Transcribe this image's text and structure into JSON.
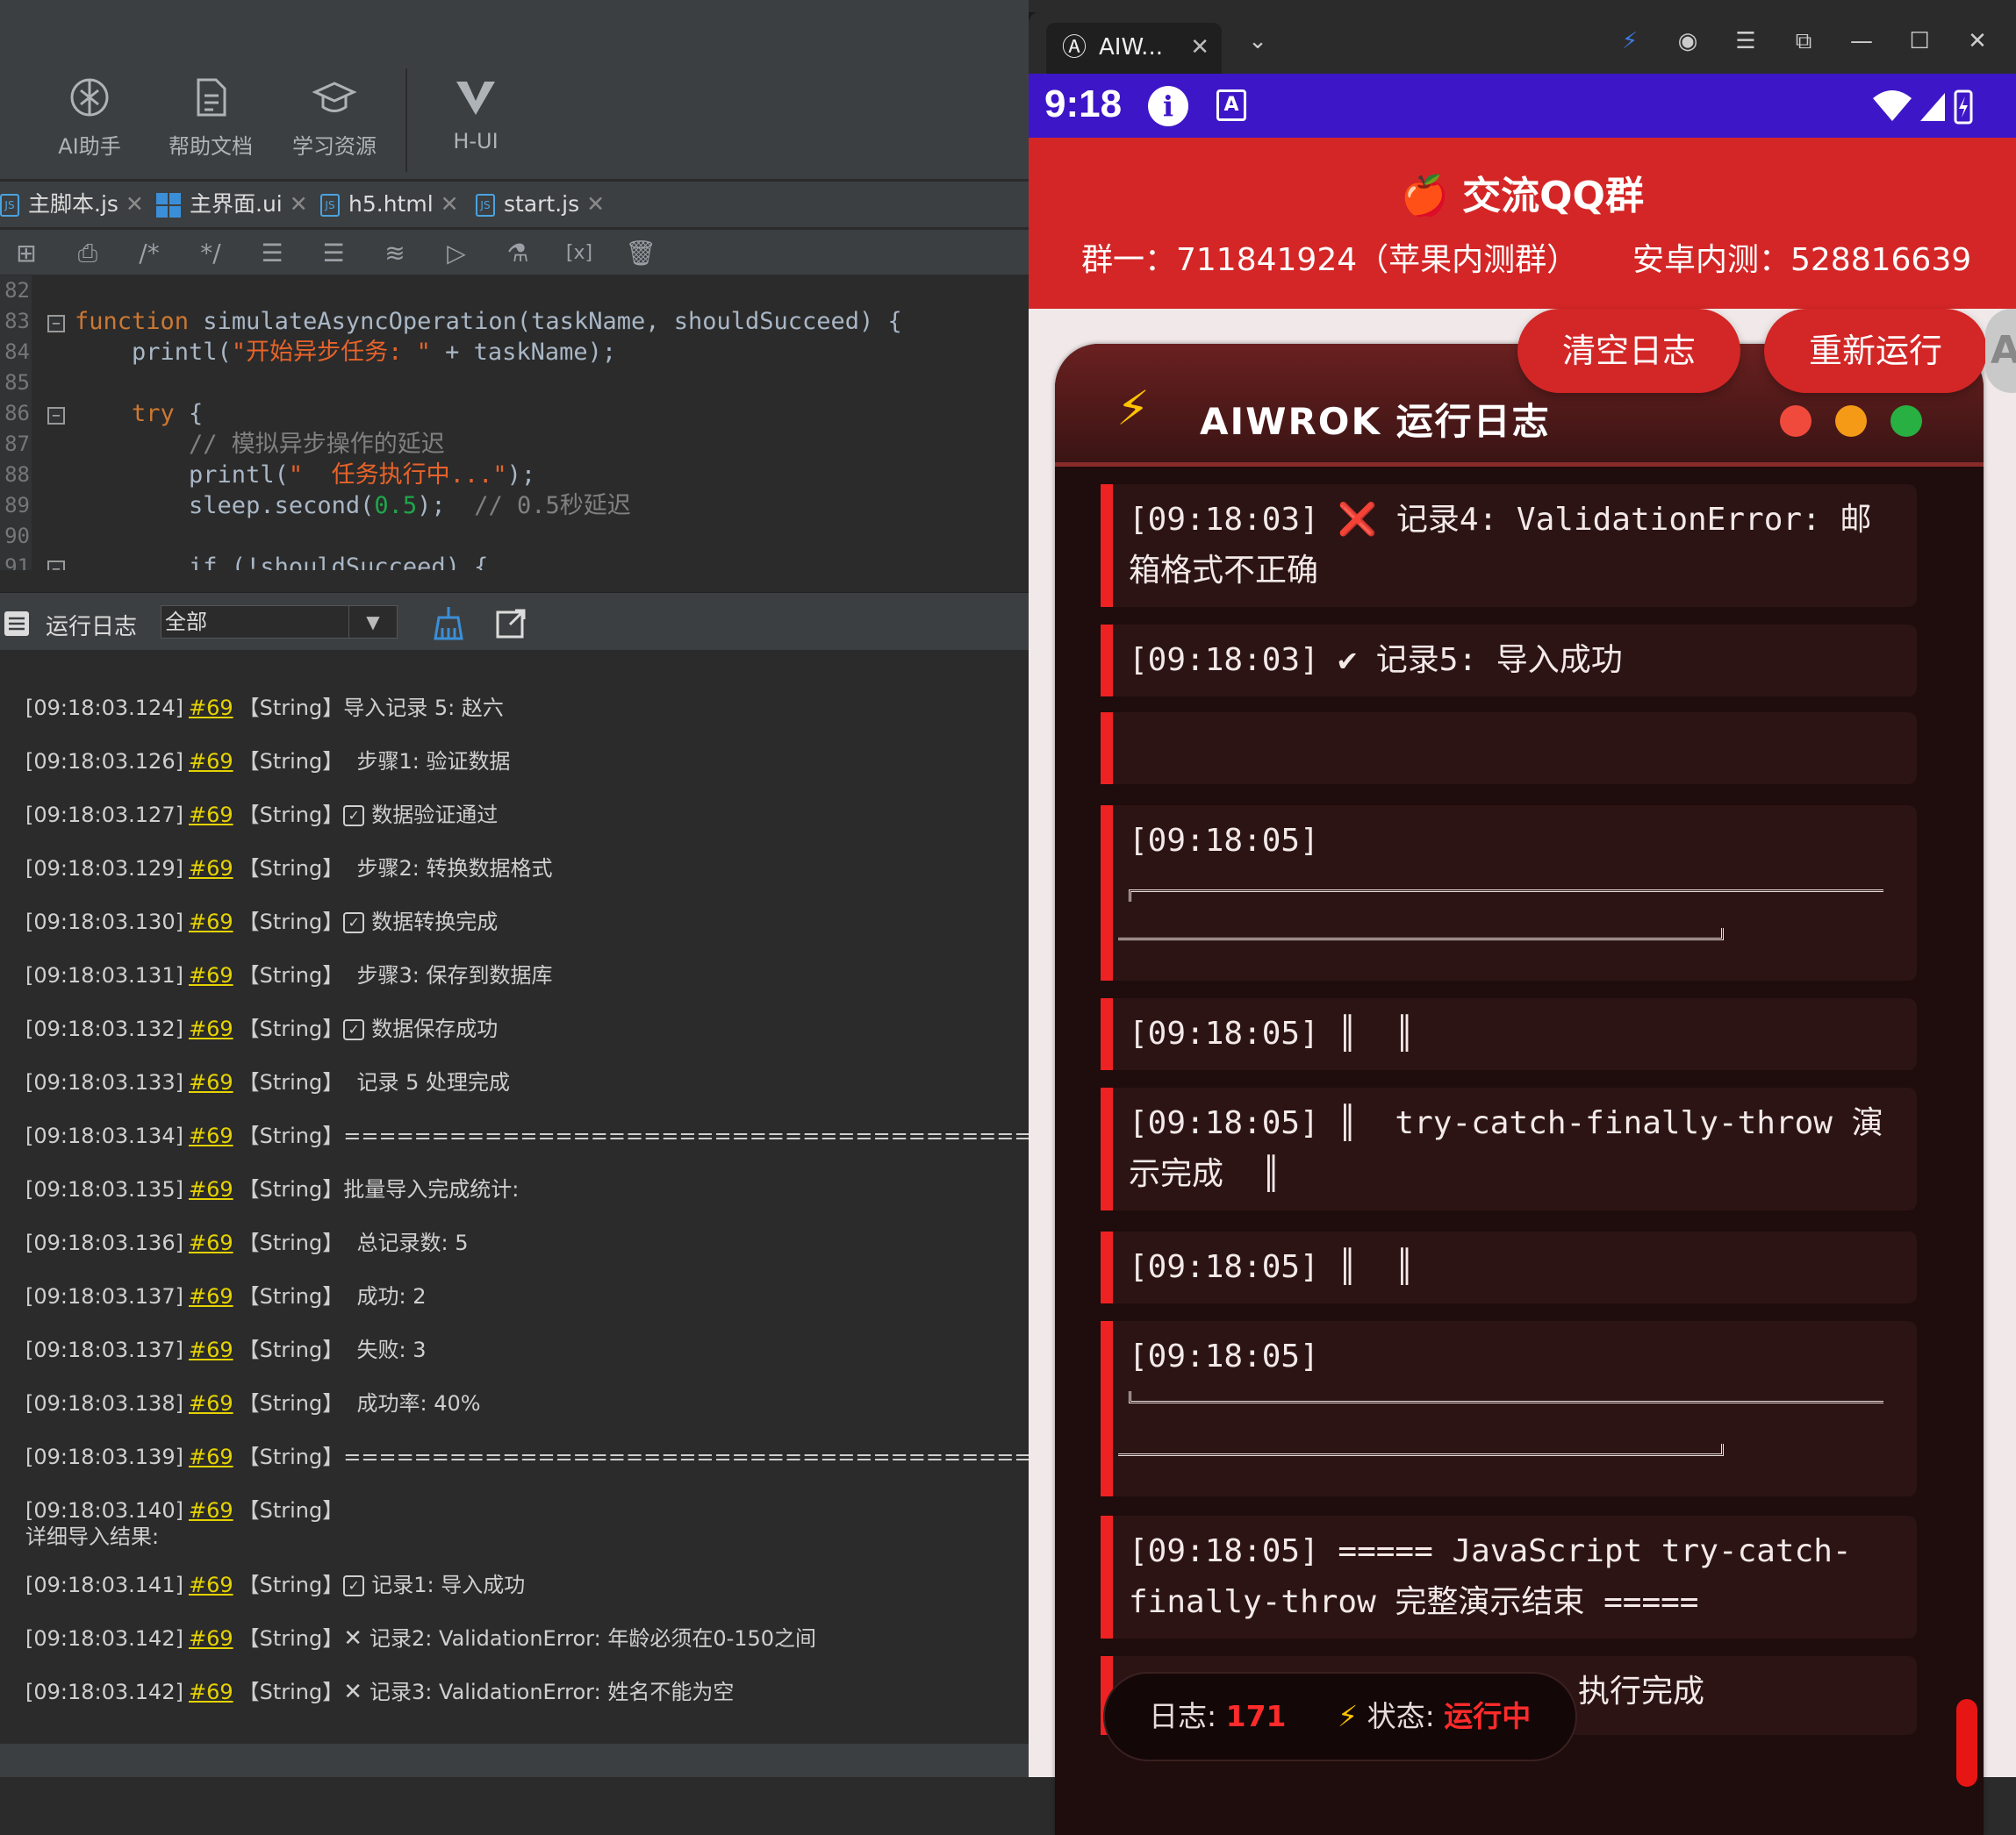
{
  "toolbar": {
    "items": [
      {
        "label": "AI助手",
        "icon": "ai-assistant-icon"
      },
      {
        "label": "帮助文档",
        "icon": "document-icon"
      },
      {
        "label": "学习资源",
        "icon": "graduation-cap-icon"
      },
      {
        "label": "H-UI",
        "icon": "h-ui-logo-icon"
      }
    ]
  },
  "tabs": [
    {
      "label": "主脚本.js"
    },
    {
      "label": "主界面.ui"
    },
    {
      "label": "h5.html"
    },
    {
      "label": "start.js"
    }
  ],
  "editor": {
    "line_numbers": [
      "82",
      "83",
      "84",
      "85",
      "86",
      "87",
      "88",
      "89",
      "90",
      "91"
    ],
    "lines": [
      {
        "k": "function",
        "t": " simulateAsyncOperation(taskName, shouldSucceed) {"
      },
      {
        "t1": "    printl(",
        "s": "\"开始异步任务: \"",
        "t2": " + taskName);"
      },
      {
        "k": "    try",
        "t": " {"
      },
      {
        "c": "        // 模拟异步操作的延迟"
      },
      {
        "t1": "        printl(",
        "s": "\"  任务执行中...\"",
        "t2": ");"
      },
      {
        "t1": "        sleep.second(",
        "n": "0.5",
        "t2": ");  ",
        "c": "// 0.5秒延迟"
      },
      {
        "t": "        if (!shouldSucceed) {"
      }
    ]
  },
  "log_toolbar": {
    "title": "运行日志",
    "filter_value": "全部"
  },
  "ide_log": [
    {
      "ts": "[09:18:03.124]",
      "id": "#69",
      "type": "【String】",
      "msg": "导入记录 5: 赵六"
    },
    {
      "ts": "[09:18:03.126]",
      "id": "#69",
      "type": "【String】",
      "msg": "  步骤1: 验证数据"
    },
    {
      "ts": "[09:18:03.127]",
      "id": "#69",
      "type": "【String】",
      "mark": "check",
      "msg": "数据验证通过"
    },
    {
      "ts": "[09:18:03.129]",
      "id": "#69",
      "type": "【String】",
      "msg": "  步骤2: 转换数据格式"
    },
    {
      "ts": "[09:18:03.130]",
      "id": "#69",
      "type": "【String】",
      "mark": "check",
      "msg": "数据转换完成"
    },
    {
      "ts": "[09:18:03.131]",
      "id": "#69",
      "type": "【String】",
      "msg": "  步骤3: 保存到数据库"
    },
    {
      "ts": "[09:18:03.132]",
      "id": "#69",
      "type": "【String】",
      "mark": "check",
      "msg": "数据保存成功"
    },
    {
      "ts": "[09:18:03.133]",
      "id": "#69",
      "type": "【String】",
      "msg": "  记录 5 处理完成"
    },
    {
      "ts": "[09:18:03.134]",
      "id": "#69",
      "type": "【String】",
      "msg": "========================================"
    },
    {
      "ts": "[09:18:03.135]",
      "id": "#69",
      "type": "【String】",
      "msg": "批量导入完成统计:"
    },
    {
      "ts": "[09:18:03.136]",
      "id": "#69",
      "type": "【String】",
      "msg": "  总记录数: 5"
    },
    {
      "ts": "[09:18:03.137]",
      "id": "#69",
      "type": "【String】",
      "msg": "  成功: 2"
    },
    {
      "ts": "[09:18:03.137]",
      "id": "#69",
      "type": "【String】",
      "msg": "  失败: 3"
    },
    {
      "ts": "[09:18:03.138]",
      "id": "#69",
      "type": "【String】",
      "msg": "  成功率: 40%"
    },
    {
      "ts": "[09:18:03.139]",
      "id": "#69",
      "type": "【String】",
      "msg": "========================================"
    },
    {
      "ts": "[09:18:03.140]",
      "id": "#69",
      "type": "【String】",
      "msg": "",
      "second": "详细导入结果:"
    },
    {
      "ts": "[09:18:03.141]",
      "id": "#69",
      "type": "【String】",
      "mark": "check",
      "msg": "记录1: 导入成功"
    },
    {
      "ts": "[09:18:03.142]",
      "id": "#69",
      "type": "【String】",
      "mark": "cross",
      "msg": "记录2: ValidationError: 年龄必须在0-150之间"
    },
    {
      "ts": "[09:18:03.142]",
      "id": "#69",
      "type": "【String】",
      "mark": "cross",
      "msg": "记录3: ValidationError: 姓名不能为空"
    }
  ],
  "window": {
    "tab_title": "AIW..."
  },
  "status_bar": {
    "time": "9:18"
  },
  "banner": {
    "title": "🍎 交流QQ群",
    "group1": "群一：711841924（苹果内测群）",
    "group2": "安卓内测：528816639"
  },
  "app": {
    "clear_button": "清空日志",
    "rerun_button": "重新运行",
    "card_title": "AIWROK 运行日志",
    "entries": [
      "[09:18:03] ❌ 记录4: ValidationError: 邮箱格式不正确",
      "[09:18:03] ✔ 记录5: 导入成功",
      "",
      "[09:18:05]",
      "[09:18:05] ║  ║",
      "[09:18:05] ║  try-catch-finally-throw 演示完成  ║",
      "[09:18:05] ║  ║",
      "[09:18:05]",
      "[09:18:05] ===== JavaScript try-catch-finally-throw 完整演示结束 =====",
      "执行完成"
    ],
    "footer": {
      "log_label": "日志: ",
      "log_count": "171",
      "status_label": "状态: ",
      "status_value": "运行中"
    }
  },
  "colors": {
    "accent_red": "#d42626",
    "status_bar": "#3d17c7",
    "log_id": "#e5d200"
  }
}
